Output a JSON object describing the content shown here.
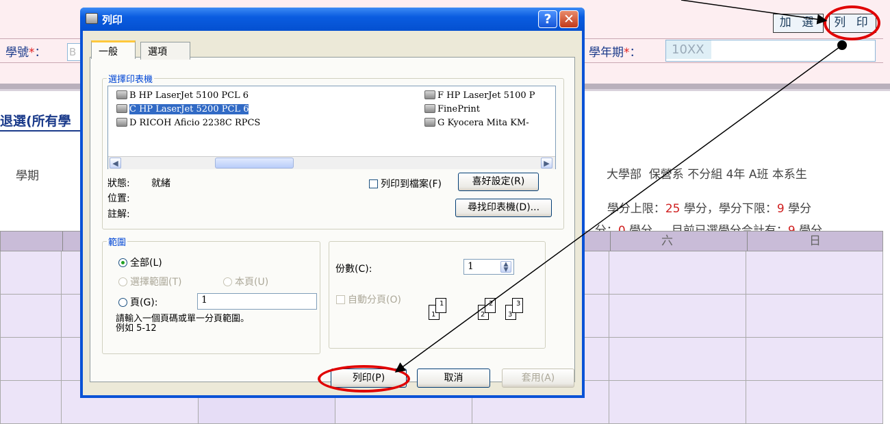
{
  "page": {
    "student_id_label": "學號",
    "student_id_value": "B",
    "required_mark": "*",
    "colon": "：",
    "term_label": "學年期",
    "term_value": "10XX",
    "add_button": "加 選",
    "print_button": "列 印",
    "section_title": "退選(所有學",
    "term_column": "學期",
    "class_info": "大學部  保營系 不分組 4年 A班 本系生",
    "credit_limits": {
      "upper_prefix": "學分上限：",
      "upper_value": "25",
      "upper_suffix": " 學分，",
      "lower_prefix": "學分下限：",
      "lower_value": "9",
      "lower_suffix": " 學分"
    },
    "credit_selected": {
      "prefix": "分：",
      "value1": "0",
      "mid": " 學分，  目前已選學分合計有：",
      "value2": "9",
      "suffix": " 學分"
    },
    "weekday_headers": [
      "六",
      "日"
    ]
  },
  "dialog": {
    "title": "列印",
    "help_button": "?",
    "close_button": "✕",
    "tabs": [
      "一般",
      "選項"
    ],
    "printer_group_label": "選擇印表機",
    "printers_left": [
      "B HP LaserJet 5100 PCL 6",
      "C HP LaserJet 5200 PCL 6",
      "D RICOH Aficio 2238C RPCS"
    ],
    "printers_right": [
      "F HP LaserJet 5100 P",
      "FinePrint",
      "G Kyocera Mita KM-"
    ],
    "selected_printer": "C HP LaserJet 5200 PCL 6",
    "status_label": "狀態:",
    "status_value": "就緒",
    "location_label": "位置:",
    "comment_label": "註解:",
    "print_to_file_label": "列印到檔案(F)",
    "preferences_button": "喜好設定(R)",
    "find_printer_button": "尋找印表機(D)...",
    "range_group_label": "範圍",
    "range_all": "全部(L)",
    "range_selection": "選擇範圍(T)",
    "range_current_page": "本頁(U)",
    "range_pages": "頁(G):",
    "pages_value": "1",
    "range_hint_line1": "請輸入一個頁碼或單一分頁範圍。",
    "range_hint_line2": "例如 5-12",
    "copies_label": "份數(C):",
    "copies_value": "1",
    "collate_label": "自動分頁(O)",
    "print_button": "列印(P)",
    "cancel_button": "取消",
    "apply_button": "套用(A)"
  },
  "colors": {
    "annotation_red": "#e00000",
    "titlebar_blue": "#0a5ce0",
    "selection_blue": "#316ac5",
    "page_pink": "#fdeef1",
    "grid_lavender": "#ece4f8"
  }
}
